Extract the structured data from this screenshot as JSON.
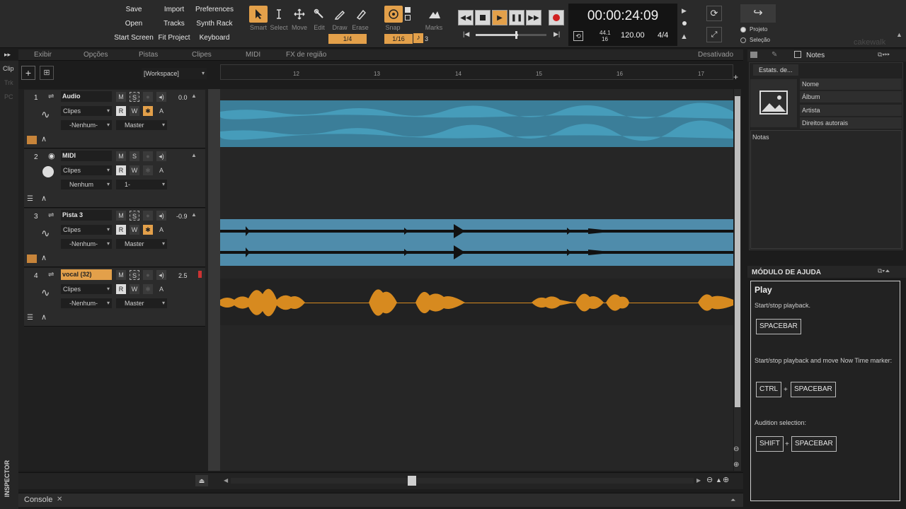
{
  "toolbar": {
    "menu_buttons": [
      "Save",
      "Import",
      "Preferences",
      "Open",
      "Tracks",
      "Synth Rack",
      "Start Screen",
      "Fit Project",
      "Keyboard"
    ],
    "tools": [
      "Smart",
      "Select",
      "Move",
      "Edit",
      "Draw",
      "Erase"
    ],
    "snap_label": "Snap",
    "snap_value": "1/4",
    "snap_value2": "1/16",
    "snap_count": "3",
    "marks_label": "Marks",
    "time": "00:00:24:09",
    "sample_rate": "44.1",
    "bit_depth": "16",
    "tempo": "120.00",
    "meter": "4/4",
    "scope_project": "Projeto",
    "scope_selection": "Seleção",
    "logo": "cakewalk"
  },
  "menu": {
    "items": [
      "Exibir",
      "Opções",
      "Pistas",
      "Clipes",
      "MIDI",
      "FX de região"
    ],
    "status": "Desativado",
    "workspace": "[Workspace]"
  },
  "side_tabs": [
    "Clip",
    "Trk",
    "PC"
  ],
  "inspector_label": "INSPECTOR",
  "ruler": [
    "12",
    "13",
    "14",
    "15",
    "16",
    "17"
  ],
  "tracks": [
    {
      "num": "1",
      "name": "Audio",
      "clips": "Clipes",
      "input": "-Nenhum-",
      "output": "Master",
      "vol": "0.0",
      "m": "M",
      "s": "S",
      "r": "R",
      "w": "W",
      "a": "A"
    },
    {
      "num": "2",
      "name": "MIDI",
      "clips": "Clipes",
      "input": "Nenhum",
      "output": "1-",
      "vol": "",
      "m": "M",
      "s": "S",
      "r": "R",
      "w": "W",
      "a": "A"
    },
    {
      "num": "3",
      "name": "Pista 3",
      "clips": "Clipes",
      "input": "-Nenhum-",
      "output": "Master",
      "vol": "-0.9",
      "m": "M",
      "s": "S",
      "r": "R",
      "w": "W",
      "a": "A"
    },
    {
      "num": "4",
      "name": "vocal (32)",
      "clips": "Clipes",
      "input": "-Nenhum-",
      "output": "Master",
      "vol": "2.5",
      "m": "M",
      "s": "S",
      "r": "R",
      "w": "W",
      "a": "A"
    }
  ],
  "notes_panel": {
    "tab": "Notes",
    "stats_button": "Estats. de...",
    "fields": [
      "Nome",
      "Álbum",
      "Artista",
      "Direitos autorais"
    ],
    "notes_label": "Notas"
  },
  "help": {
    "header": "MÓDULO DE AJUDA",
    "title": "Play",
    "desc1": "Start/stop playback.",
    "key1": "SPACEBAR",
    "desc2": "Start/stop playback and move Now Time marker:",
    "key2a": "CTRL",
    "key2b": "SPACEBAR",
    "desc3": "Audition selection:",
    "key3a": "SHIFT",
    "key3b": "SPACEBAR",
    "plus": "+"
  },
  "console": {
    "label": "Console",
    "close": "✕"
  },
  "colors": {
    "accent": "#e3a04a",
    "audio_clip": "#3d8aa4",
    "pista_clip": "#4f8cab",
    "vocal_wave": "#d78a1f"
  }
}
